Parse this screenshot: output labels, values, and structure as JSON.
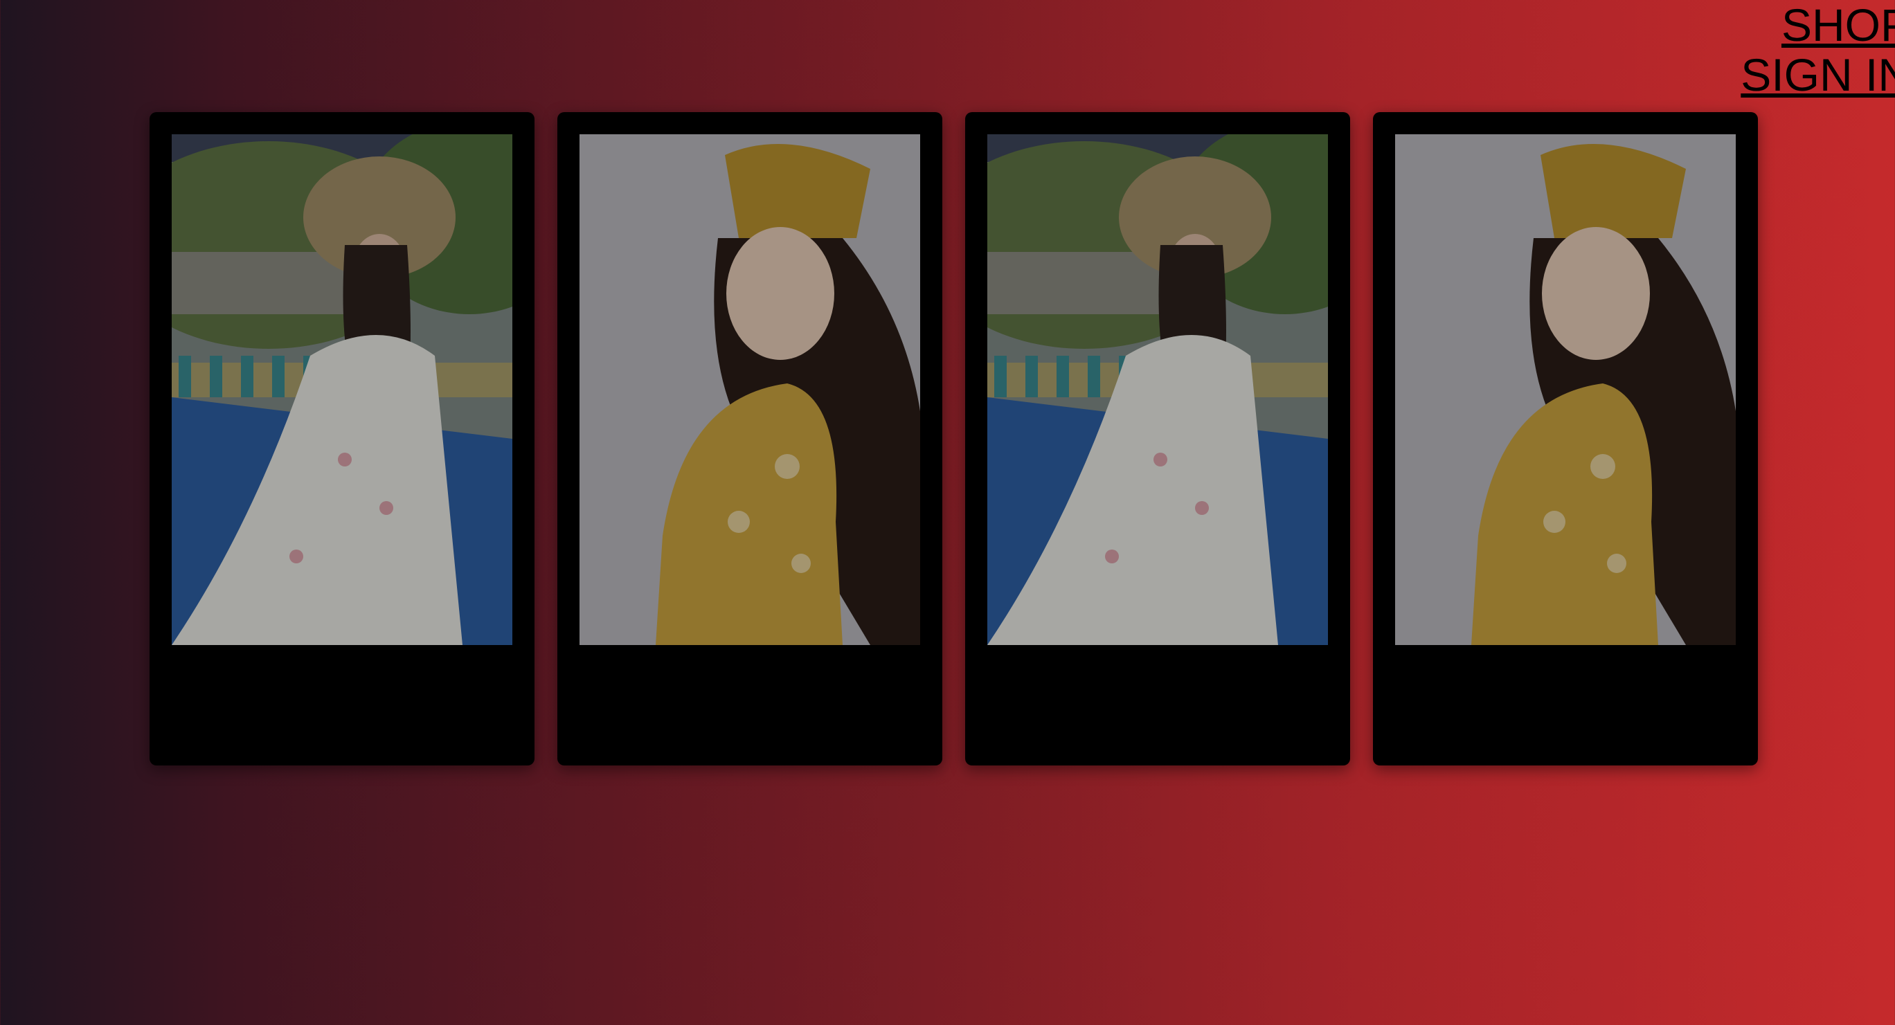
{
  "nav": {
    "shop_label": "SHOP",
    "signin_label": "SIGN IN"
  },
  "gallery": {
    "cards": [
      {
        "image": "woman-straw-hat-floral-dress-photo"
      },
      {
        "image": "woman-gold-headpiece-gown-photo"
      },
      {
        "image": "woman-straw-hat-floral-dress-photo"
      },
      {
        "image": "woman-gold-headpiece-gown-photo"
      }
    ]
  },
  "colors": {
    "gradient_start": "#1f1420",
    "gradient_end": "#c52a2c",
    "card_bg": "#000000"
  }
}
